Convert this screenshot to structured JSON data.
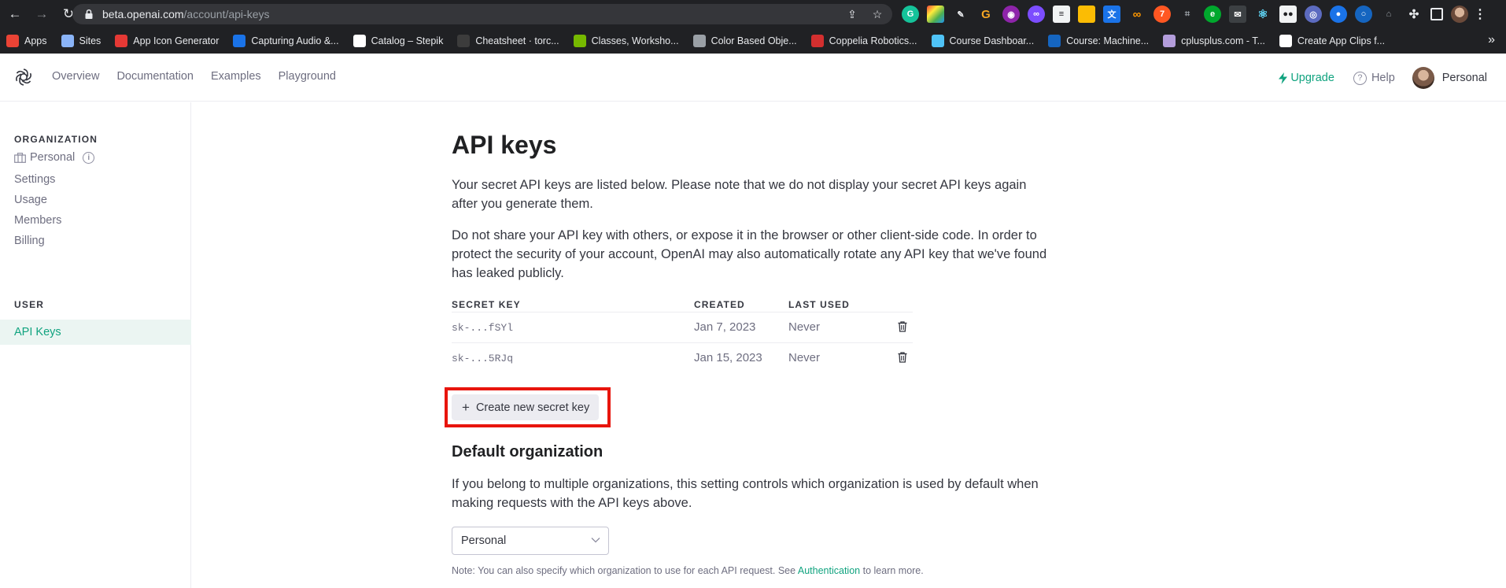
{
  "browser": {
    "url_host": "beta.openai.com",
    "url_path": "/account/api-keys",
    "bookmarks": [
      {
        "label": "Apps",
        "color": "#ea4335"
      },
      {
        "label": "Sites",
        "color": "#8ab4f8"
      },
      {
        "label": "App Icon Generator",
        "color": "#e53935"
      },
      {
        "label": "Capturing Audio &...",
        "color": "#1a73e8"
      },
      {
        "label": "Catalog – Stepik",
        "color": "#ffffff"
      },
      {
        "label": "Cheatsheet · torc...",
        "color": "#3c3c3c"
      },
      {
        "label": "Classes, Worksho...",
        "color": "#76b900"
      },
      {
        "label": "Color Based Obje...",
        "color": "#9aa0a6"
      },
      {
        "label": "Coppelia Robotics...",
        "color": "#d32f2f"
      },
      {
        "label": "Course Dashboar...",
        "color": "#4fc3f7"
      },
      {
        "label": "Course: Machine...",
        "color": "#1565c0"
      },
      {
        "label": "cplusplus.com - T...",
        "color": "#b39ddb"
      },
      {
        "label": "Create App Clips f...",
        "color": "#ffffff"
      }
    ],
    "more_icon": "»"
  },
  "header": {
    "nav": [
      "Overview",
      "Documentation",
      "Examples",
      "Playground"
    ],
    "upgrade_label": "Upgrade",
    "help_label": "Help",
    "account_label": "Personal",
    "accent": "#10a37f"
  },
  "sidebar": {
    "org_heading": "ORGANIZATION",
    "org_name": "Personal",
    "org_items": [
      "Settings",
      "Usage",
      "Members",
      "Billing"
    ],
    "user_heading": "USER",
    "user_items": [
      "API Keys"
    ]
  },
  "main": {
    "title": "API keys",
    "intro_1": "Your secret API keys are listed below. Please note that we do not display your secret API keys again after you generate them.",
    "intro_2": "Do not share your API key with others, or expose it in the browser or other client-side code. In order to protect the security of your account, OpenAI may also automatically rotate any API key that we've found has leaked publicly.",
    "table": {
      "headers": [
        "SECRET KEY",
        "CREATED",
        "LAST USED"
      ],
      "rows": [
        {
          "key": "sk-...fSYl",
          "created": "Jan 7, 2023",
          "last_used": "Never"
        },
        {
          "key": "sk-...5RJq",
          "created": "Jan 15, 2023",
          "last_used": "Never"
        }
      ]
    },
    "create_label": "Create new secret key",
    "default_org_title": "Default organization",
    "default_org_desc": "If you belong to multiple organizations, this setting controls which organization is used by default when making requests with the API keys above.",
    "select_value": "Personal",
    "note_prefix": "Note: You can also specify which organization to use for each API request. See",
    "note_link": "Authentication",
    "note_suffix": "to learn more.",
    "highlight_color": "#e8150d"
  }
}
